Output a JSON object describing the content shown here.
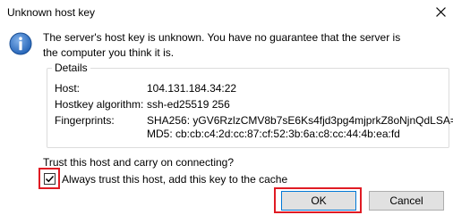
{
  "window": {
    "title": "Unknown host key",
    "close_icon": "close-icon"
  },
  "message": {
    "line1": "The server's host key is unknown. You have no guarantee that the server is",
    "line2": "the computer you think it is."
  },
  "details": {
    "title": "Details",
    "host_label": "Host:",
    "host_value": "104.131.184.34:22",
    "algo_label": "Hostkey algorithm:",
    "algo_value": "ssh-ed25519 256",
    "fp_label": "Fingerprints:",
    "fp_sha256": "SHA256: yGV6RzlzCMV8b7sE6Ks4fjd3pg4mjprkZ8oNjnQdLSA=",
    "fp_md5": "MD5: cb:cb:c4:2d:cc:87:cf:52:3b:6a:c8:cc:44:4b:ea:fd"
  },
  "question": "Trust this host and carry on connecting?",
  "checkbox": {
    "label": "Always trust this host, add this key to the cache",
    "checked": true
  },
  "buttons": {
    "ok": "OK",
    "cancel": "Cancel"
  },
  "colors": {
    "highlight": "#e01b24",
    "info_blue": "#1f5fb4"
  }
}
